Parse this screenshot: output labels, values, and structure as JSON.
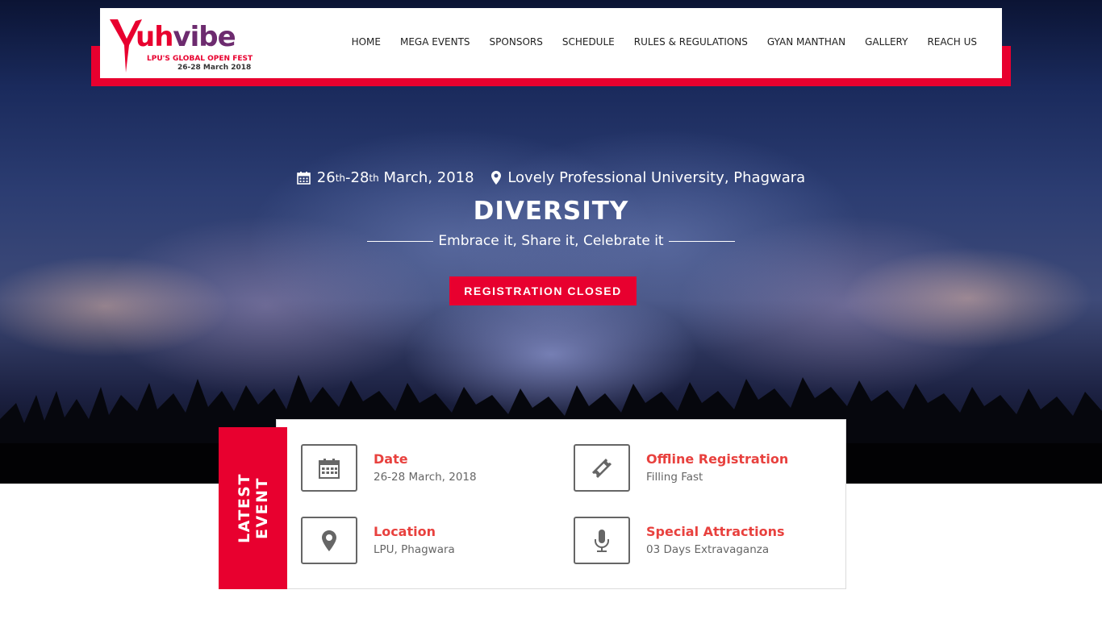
{
  "header": {
    "logo": {
      "word_first": "Y",
      "word_mid": "uh",
      "word_rest": "vibe",
      "subtitle": "LPU'S GLOBAL OPEN FEST",
      "dates": "26-28 March 2018"
    },
    "nav": [
      {
        "label": "HOME"
      },
      {
        "label": "MEGA EVENTS"
      },
      {
        "label": "SPONSORS"
      },
      {
        "label": "SCHEDULE"
      },
      {
        "label": "RULES & REGULATIONS"
      },
      {
        "label": "GYAN MANTHAN"
      },
      {
        "label": "GALLERY"
      },
      {
        "label": "REACH US"
      }
    ]
  },
  "hero": {
    "date": {
      "start_day": "26",
      "start_sup": "th",
      "sep": "-",
      "end_day": "28",
      "end_sup": "th",
      "rest": " March, 2018"
    },
    "location": "Lovely Professional University, Phagwara",
    "title": "DIVERSITY",
    "tagline": "Embrace it, Share it, Celebrate it",
    "button": "REGISTRATION CLOSED"
  },
  "event": {
    "label_line1": "LATEST",
    "label_line2": "EVENT",
    "items": [
      {
        "title": "Date",
        "value": "26-28 March, 2018",
        "icon": "calendar-icon"
      },
      {
        "title": "Offline Registration",
        "value": "Filling Fast",
        "icon": "ticket-icon"
      },
      {
        "title": "Location",
        "value": "LPU, Phagwara",
        "icon": "map-marker-icon"
      },
      {
        "title": "Special Attractions",
        "value": "03 Days Extravaganza",
        "icon": "microphone-icon"
      }
    ]
  },
  "colors": {
    "accent": "#e8002f",
    "title_red": "#e8413e",
    "text_dark": "#222222"
  }
}
